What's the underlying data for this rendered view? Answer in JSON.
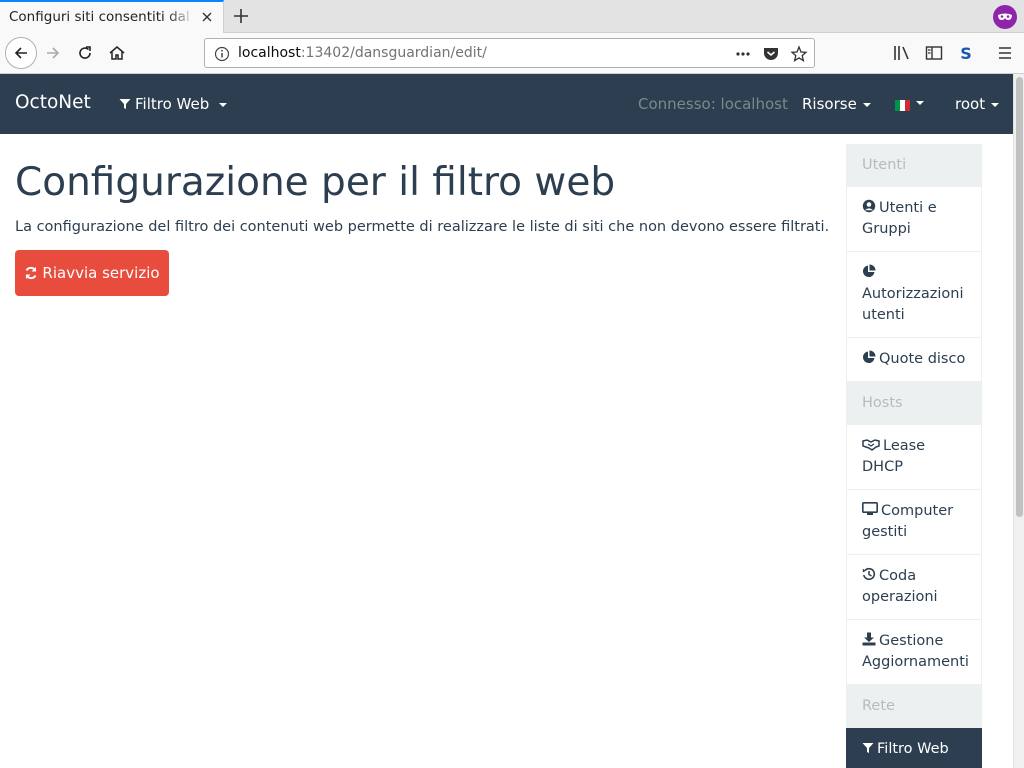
{
  "browser": {
    "tab_title": "Configuri siti consentiti dal filtro web",
    "url_host": "localhost",
    "url_rest": ":13402/dansguardian/edit/"
  },
  "navbar": {
    "brand": "OctoNet",
    "filter_menu": "Filtro Web",
    "connected": "Connesso: localhost",
    "resources": "Risorse",
    "user": "root",
    "bg_color": "#2c3e50"
  },
  "main": {
    "title": "Configurazione per il filtro web",
    "description": "La configurazione del filtro dei contenuti web permette di realizzare le liste di siti che non devono essere filtrati.",
    "restart_button": "Riavvia servizio",
    "danger_color": "#e74c3c"
  },
  "sidebar": {
    "header_users": "Utenti",
    "users_groups": "Utenti e Gruppi",
    "user_auth": "Autorizzazioni utenti",
    "disk_quota": "Quote disco",
    "header_hosts": "Hosts",
    "dhcp_lease": "Lease DHCP",
    "managed_computers": "Computer gestiti",
    "operation_queue": "Coda operazioni",
    "updates": "Gestione Aggiornamenti",
    "header_network": "Rete",
    "web_filter": "Filtro Web"
  }
}
